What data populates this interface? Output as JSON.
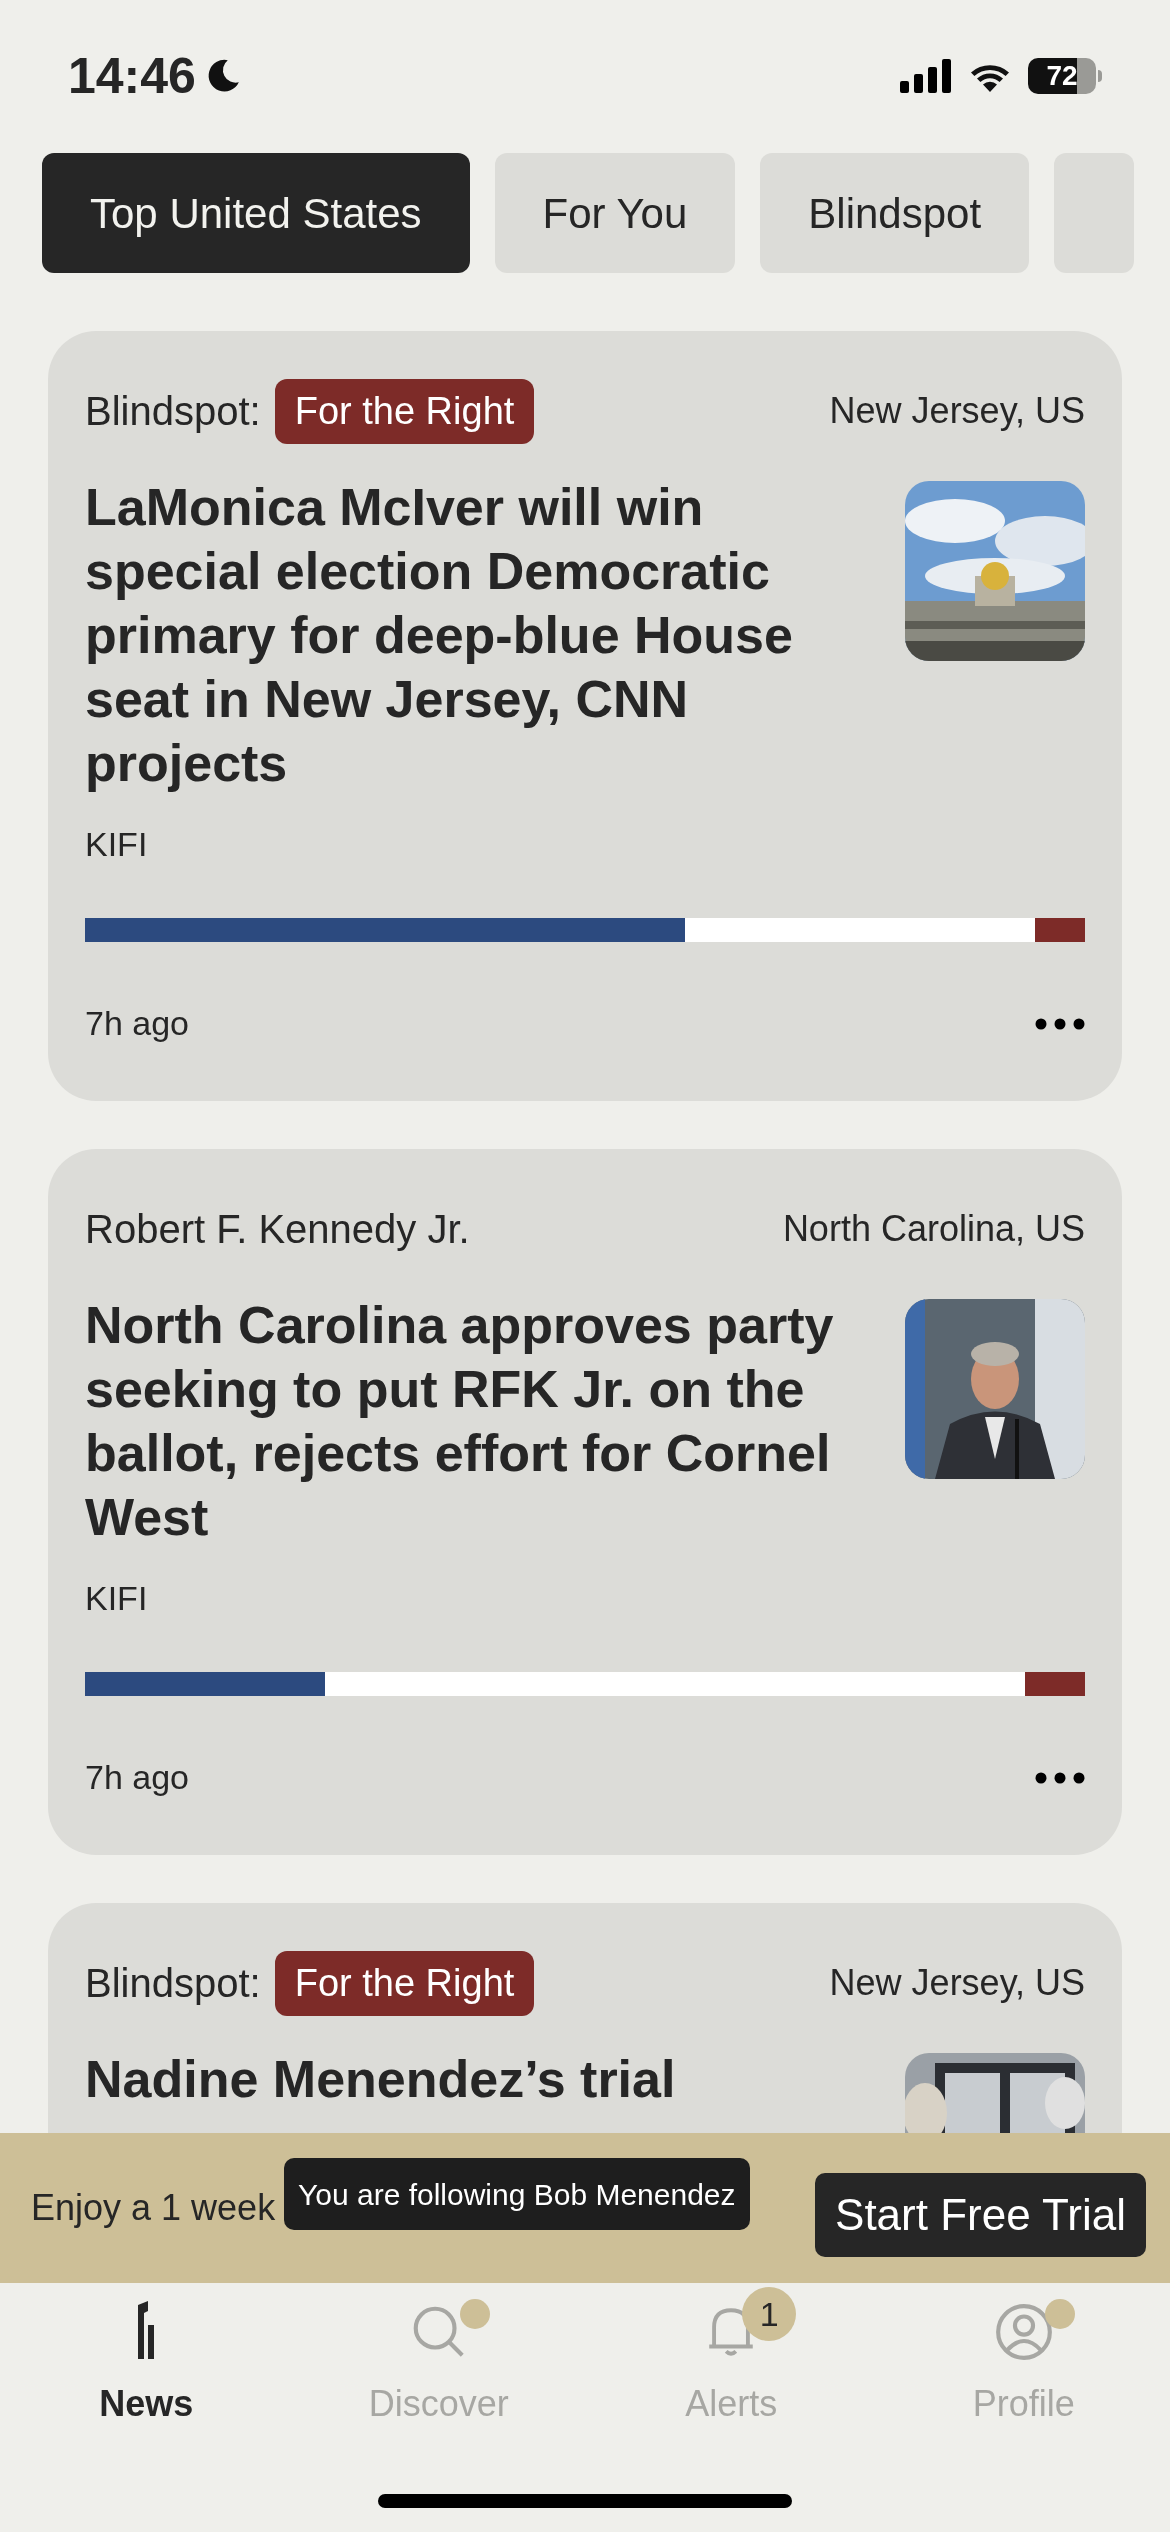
{
  "status_bar": {
    "time": "14:46",
    "battery": "72"
  },
  "tabs": [
    {
      "label": "Top United States",
      "selected": true
    },
    {
      "label": "For You",
      "selected": false
    },
    {
      "label": "Blindspot",
      "selected": false
    }
  ],
  "stories": [
    {
      "topic": "Blindspot:",
      "tag": "For the Right",
      "location": "New Jersey, US",
      "headline": "LaMonica McIver will win special election Democratic primary for deep-blue House seat in New Jersey, CNN projects",
      "source": "KIFI",
      "bias": [
        {
          "kind": "left",
          "level": 0.6
        },
        {
          "kind": "right",
          "level": 0.05
        }
      ],
      "time": "7h ago"
    },
    {
      "topic": "Robert F. Kennedy Jr.",
      "location": "North Carolina, US",
      "headline": "North Carolina approves party seeking to put RFK Jr. on the ballot, rejects effort for Cornel West",
      "source": "KIFI",
      "bias": [
        {
          "kind": "left",
          "level": 0.24
        },
        {
          "kind": "right",
          "level": 0.06
        }
      ],
      "time": "7h ago"
    },
    {
      "topic": "Blindspot:",
      "tag": "For the Right",
      "location": "New Jersey, US",
      "headline": "Nadine Menendez’s trial"
    }
  ],
  "banner": {
    "text": "Enjoy a 1 week",
    "button": "Start Free Trial"
  },
  "toast": "You are following Bob Menendez",
  "nav": [
    {
      "kind": "logo",
      "label": "News",
      "selected": true,
      "dot": false
    },
    {
      "kind": "search",
      "label": "Discover",
      "selected": false,
      "dot": true
    },
    {
      "kind": "bell",
      "label": "Alerts",
      "selected": false,
      "dot": false,
      "badge": "1"
    },
    {
      "kind": "profile",
      "label": "Profile",
      "selected": false,
      "dot": true
    }
  ]
}
